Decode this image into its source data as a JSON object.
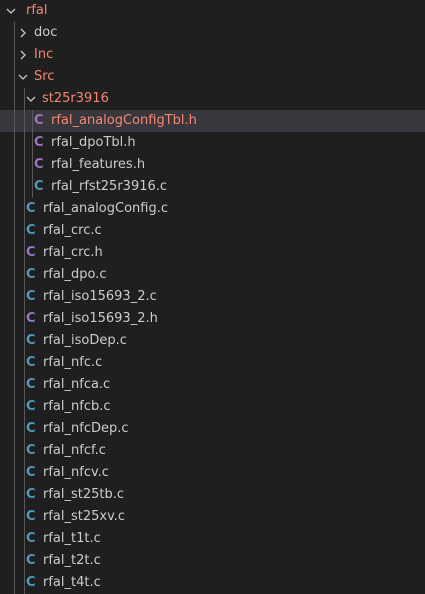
{
  "colors": {
    "c_source_icon": "#519aba",
    "c_header_icon": "#a074c4",
    "modified_text": "#f48771",
    "default_text": "#cccccc",
    "background": "#1f1f1f",
    "selected_row": "#37373d"
  },
  "tree": [
    {
      "label": "rfal",
      "type": "folder",
      "depth": 0,
      "expanded": true,
      "modified": true
    },
    {
      "label": "doc",
      "type": "folder",
      "depth": 1,
      "expanded": false,
      "modified": false
    },
    {
      "label": "Inc",
      "type": "folder",
      "depth": 1,
      "expanded": false,
      "modified": true
    },
    {
      "label": "Src",
      "type": "folder",
      "depth": 1,
      "expanded": true,
      "modified": true
    },
    {
      "label": "st25r3916",
      "type": "folder",
      "depth": 2,
      "expanded": true,
      "modified": true
    },
    {
      "label": "rfal_analogConfigTbl.h",
      "type": "h",
      "icon_letter": "C",
      "depth": 3,
      "modified": true,
      "selected": true
    },
    {
      "label": "rfal_dpoTbl.h",
      "type": "h",
      "icon_letter": "C",
      "depth": 3
    },
    {
      "label": "rfal_features.h",
      "type": "h",
      "icon_letter": "C",
      "depth": 3
    },
    {
      "label": "rfal_rfst25r3916.c",
      "type": "c",
      "icon_letter": "C",
      "depth": 3
    },
    {
      "label": "rfal_analogConfig.c",
      "type": "c",
      "icon_letter": "C",
      "depth": 2
    },
    {
      "label": "rfal_crc.c",
      "type": "c",
      "icon_letter": "C",
      "depth": 2
    },
    {
      "label": "rfal_crc.h",
      "type": "h",
      "icon_letter": "C",
      "depth": 2
    },
    {
      "label": "rfal_dpo.c",
      "type": "c",
      "icon_letter": "C",
      "depth": 2
    },
    {
      "label": "rfal_iso15693_2.c",
      "type": "c",
      "icon_letter": "C",
      "depth": 2
    },
    {
      "label": "rfal_iso15693_2.h",
      "type": "h",
      "icon_letter": "C",
      "depth": 2
    },
    {
      "label": "rfal_isoDep.c",
      "type": "c",
      "icon_letter": "C",
      "depth": 2
    },
    {
      "label": "rfal_nfc.c",
      "type": "c",
      "icon_letter": "C",
      "depth": 2
    },
    {
      "label": "rfal_nfca.c",
      "type": "c",
      "icon_letter": "C",
      "depth": 2
    },
    {
      "label": "rfal_nfcb.c",
      "type": "c",
      "icon_letter": "C",
      "depth": 2
    },
    {
      "label": "rfal_nfcDep.c",
      "type": "c",
      "icon_letter": "C",
      "depth": 2
    },
    {
      "label": "rfal_nfcf.c",
      "type": "c",
      "icon_letter": "C",
      "depth": 2
    },
    {
      "label": "rfal_nfcv.c",
      "type": "c",
      "icon_letter": "C",
      "depth": 2
    },
    {
      "label": "rfal_st25tb.c",
      "type": "c",
      "icon_letter": "C",
      "depth": 2
    },
    {
      "label": "rfal_st25xv.c",
      "type": "c",
      "icon_letter": "C",
      "depth": 2
    },
    {
      "label": "rfal_t1t.c",
      "type": "c",
      "icon_letter": "C",
      "depth": 2
    },
    {
      "label": "rfal_t2t.c",
      "type": "c",
      "icon_letter": "C",
      "depth": 2
    },
    {
      "label": "rfal_t4t.c",
      "type": "c",
      "icon_letter": "C",
      "depth": 2
    }
  ]
}
